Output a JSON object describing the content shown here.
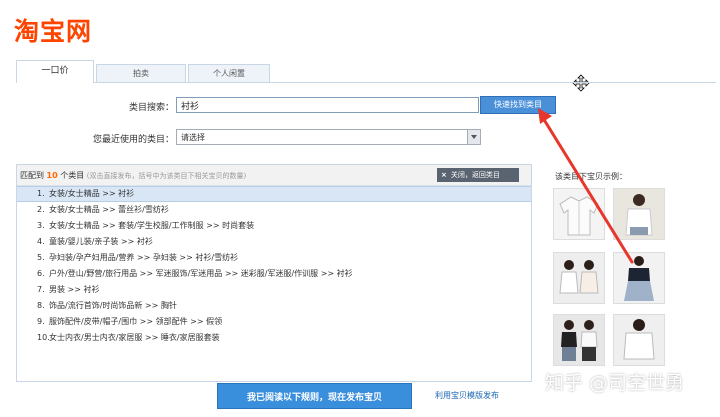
{
  "logo": {
    "text": "淘宝网"
  },
  "tabs": [
    {
      "label": "一口价"
    },
    {
      "label": "拍卖"
    },
    {
      "label": "个人闲置"
    }
  ],
  "form": {
    "category_search_label": "类目搜索：",
    "category_search_value": "衬衫",
    "quick_find_button": "快速找到类目",
    "recent_label": "您最近使用的类目：",
    "recent_value": "请选择"
  },
  "results": {
    "matched_prefix": "匹配到",
    "matched_count": "10",
    "matched_suffix": "个类目",
    "hint": "(双击直接发布，括号中为该类目下相关宝贝的数量)",
    "close_icon": "×",
    "close_label": "关闭，返回类目",
    "items": [
      {
        "num": "1.",
        "text": "女装/女士精品 >> 衬衫"
      },
      {
        "num": "2.",
        "text": "女装/女士精品 >> 蕾丝衫/雪纺衫"
      },
      {
        "num": "3.",
        "text": "女装/女士精品 >> 套装/学生校服/工作制服 >> 时尚套装"
      },
      {
        "num": "4.",
        "text": "童装/婴儿装/亲子装 >> 衬衫"
      },
      {
        "num": "5.",
        "text": "孕妇装/孕产妇用品/营养 >> 孕妇装 >> 衬衫/雪纺衫"
      },
      {
        "num": "6.",
        "text": "户外/登山/野营/旅行用品 >> 军迷服饰/军迷用品 >> 迷彩服/军迷服/作训服 >> 衬衫"
      },
      {
        "num": "7.",
        "text": "男装 >> 衬衫"
      },
      {
        "num": "8.",
        "text": "饰品/流行首饰/时尚饰品新 >> 胸针"
      },
      {
        "num": "9.",
        "text": "服饰配件/皮带/帽子/围巾 >> 领部配件 >> 假领"
      },
      {
        "num": "10.",
        "text": "女士内衣/男士内衣/家居服 >> 睡衣/家居服套装"
      }
    ]
  },
  "examples": {
    "title": "该类目下宝贝示例："
  },
  "bottom": {
    "publish_button": "我已阅读以下规则，现在发布宝贝",
    "template_link": "利用宝贝模版发布"
  },
  "watermark": "知乎 @司空世勇",
  "colors": {
    "brand": "#ff4400",
    "accent": "#3a8fdc",
    "annotation": "#e8362c",
    "highlight": "#ff6600"
  }
}
